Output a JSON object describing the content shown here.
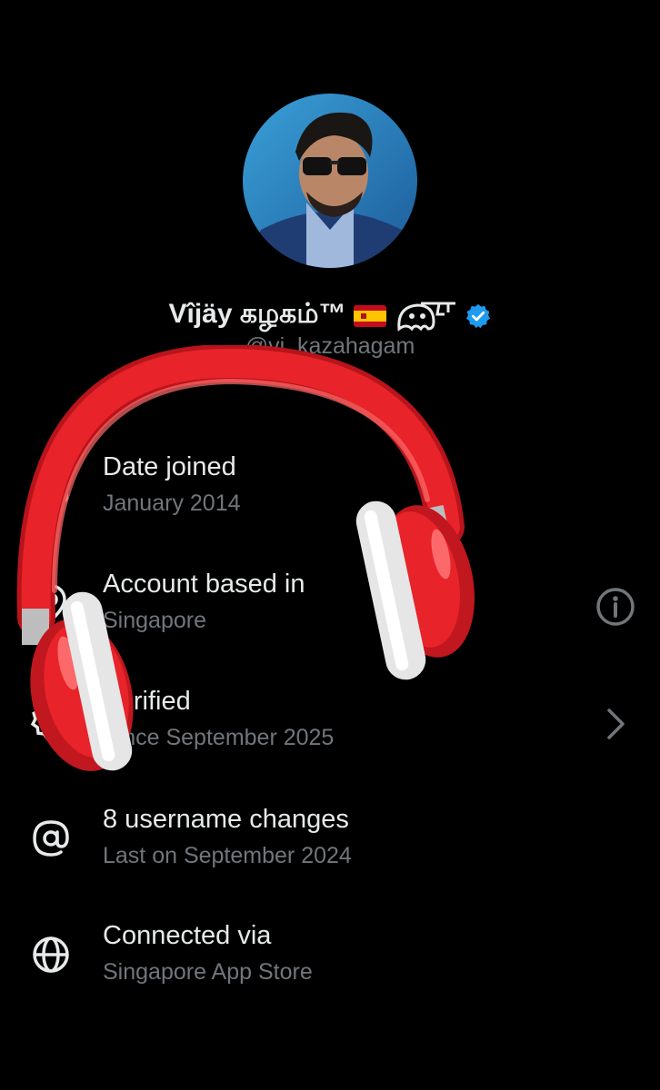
{
  "profile": {
    "display_name": "Vîjäy கழகம்™",
    "handle": "@vj_kazahagam",
    "avatar_icon": "profile-photo",
    "flag_icon": "spain-flag",
    "emoji_icon": "ghost-emoji",
    "verified_icon": "verified-badge",
    "verified_color": "#1d9bf0"
  },
  "rows": [
    {
      "icon": "calendar-icon",
      "title": "Date joined",
      "subtitle": "January 2014"
    },
    {
      "icon": "location-icon",
      "title": "Account based in",
      "subtitle": "Singapore",
      "right_icon": "info-icon"
    },
    {
      "icon": "verified-outline-icon",
      "title": "Verified",
      "subtitle": "Since September 2025",
      "right_icon": "chevron-right-icon"
    },
    {
      "icon": "at-icon",
      "title": "8 username changes",
      "subtitle": "Last on September 2024"
    },
    {
      "icon": "globe-icon",
      "title": "Connected via",
      "subtitle": "Singapore App Store"
    }
  ],
  "overlay": {
    "icon": "headphones-sticker",
    "color": "#e8232a"
  },
  "colors": {
    "background": "#000000",
    "primary_text": "#e7e9ea",
    "secondary_text": "#71767b"
  }
}
